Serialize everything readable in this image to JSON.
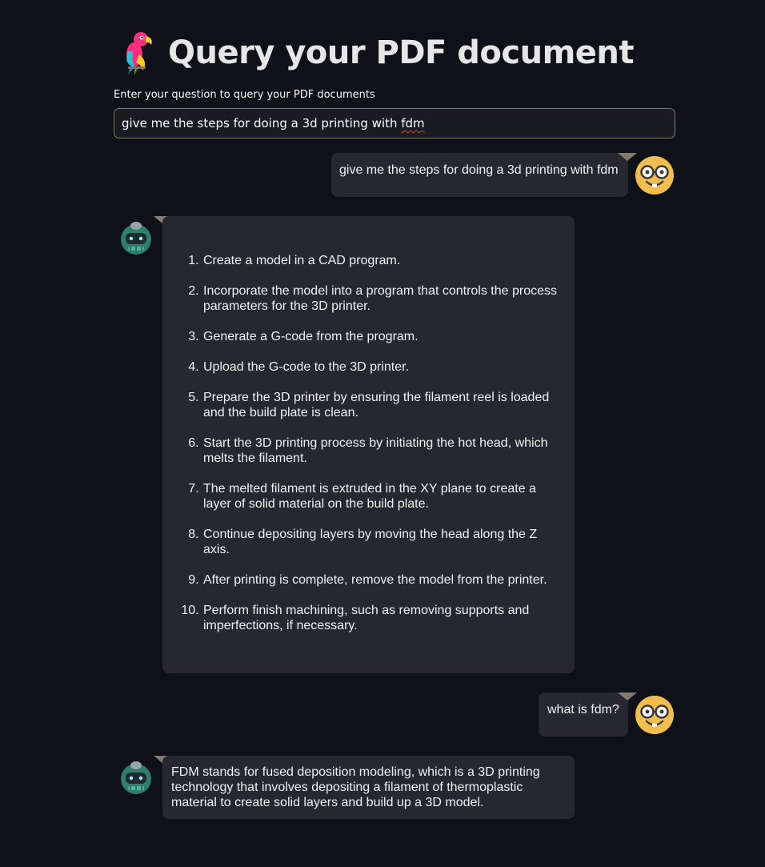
{
  "header": {
    "title": "Query your PDF document",
    "icon": "parrot-icon"
  },
  "query_input": {
    "label": "Enter your question to query your PDF documents",
    "value_prefix": "give me the steps for doing a 3d printing with ",
    "value_flagged_word": "fdm"
  },
  "messages": [
    {
      "role": "user",
      "text": "give me the steps for doing a 3d printing with fdm",
      "avatar": "nerd-face-icon"
    },
    {
      "role": "bot",
      "avatar": "robot-icon",
      "steps": [
        "Create a model in a CAD program.",
        "Incorporate the model into a program that controls the process parameters for the 3D printer.",
        "Generate a G-code from the program.",
        "Upload the G-code to the 3D printer.",
        "Prepare the 3D printer by ensuring the filament reel is loaded and the build plate is clean.",
        "Start the 3D printing process by initiating the hot head, which melts the filament.",
        "The melted filament is extruded in the XY plane to create a layer of solid material on the build plate.",
        "Continue depositing layers by moving the head along the Z axis.",
        "After printing is complete, remove the model from the printer.",
        "Perform finish machining, such as removing supports and imperfections, if necessary."
      ]
    },
    {
      "role": "user",
      "text": "what is fdm?",
      "avatar": "nerd-face-icon"
    },
    {
      "role": "bot",
      "avatar": "robot-icon",
      "text": "FDM stands for fused deposition modeling, which is a 3D printing technology that involves depositing a filament of thermoplastic material to create solid layers and build up a 3D model."
    }
  ],
  "colors": {
    "background": "#0e1117",
    "bubble": "#262730",
    "input_border": "#7b7866",
    "notch": "#847a6d",
    "avatar_face": "#f0bd4e"
  }
}
